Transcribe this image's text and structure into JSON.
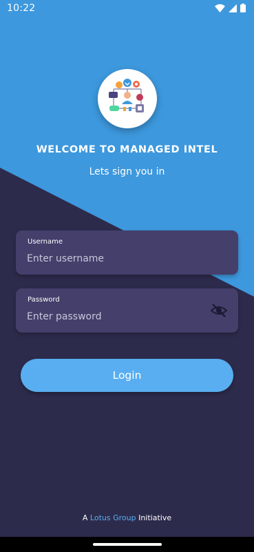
{
  "status_bar": {
    "time": "10:22",
    "icons": [
      "wifi-icon",
      "signal-icon",
      "battery-icon"
    ]
  },
  "branding": {
    "logo_icon": "team-network-illustration",
    "welcome_title": "WELCOME TO MANAGED INTEL",
    "subtitle": "Lets sign you in"
  },
  "form": {
    "username": {
      "label": "Username",
      "placeholder": "Enter username",
      "value": ""
    },
    "password": {
      "label": "Password",
      "placeholder": "Enter password",
      "value": "",
      "visibility_icon": "eye-off-icon"
    },
    "login_label": "Login"
  },
  "footer": {
    "prefix": "A",
    "brand": "Lotus Group",
    "suffix": "Initiative"
  },
  "colors": {
    "top_background": "#3d98dd",
    "bottom_background": "#2d2b4c",
    "field_background": "#443f6b",
    "accent": "#58aef0"
  }
}
